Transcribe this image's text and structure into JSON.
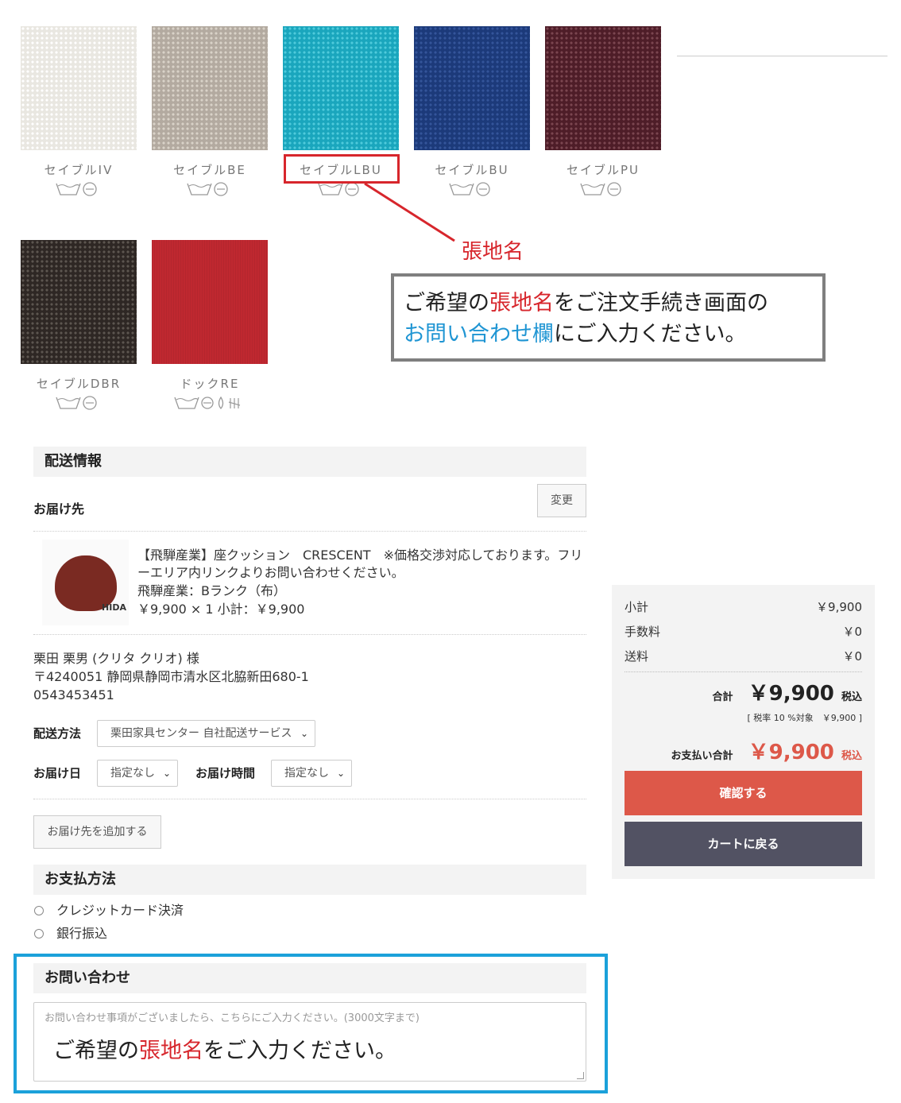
{
  "swatches": [
    {
      "name": "セイブルIV",
      "care_icons": "wash-tub, no-bleach-circle"
    },
    {
      "name": "セイブルBE",
      "care_icons": "wash-tub, no-bleach-circle"
    },
    {
      "name": "セイブルLBU",
      "care_icons": "wash-tub, no-bleach-circle"
    },
    {
      "name": "セイブルBU",
      "care_icons": "wash-tub, no-bleach-circle"
    },
    {
      "name": "セイブルPU",
      "care_icons": "wash-tub, no-bleach-circle"
    },
    {
      "name": "セイブルDBR",
      "care_icons": "wash-tub, no-bleach-circle"
    },
    {
      "name": "ドックRE",
      "care_icons": "wash-tub, no-bleach-circle, drop, steam"
    }
  ],
  "annotation": {
    "label": "張地名",
    "box_part1": "ご希望の",
    "box_red": "張地名",
    "box_part2": "をご注文手続き画面の",
    "box_blue": "お問い合わせ欄",
    "box_part3": "にご入力ください。",
    "accent_red": "#d7262c",
    "accent_blue": "#1ba1da"
  },
  "delivery": {
    "section_title": "配送情報",
    "destination_label": "お届け先",
    "change_button": "変更",
    "product": {
      "title": "【飛騨産業】座クッション　CRESCENT　※価格交渉対応しております。フリーエリア内リンクよりお問い合わせください。",
      "variant": "飛騨産業：Bランク（布）",
      "price_line": "￥9,900 × 1  小計：￥9,900",
      "image_brand": "HIDA"
    },
    "address": {
      "name": "栗田 栗男 (クリタ クリオ) 様",
      "postal_address": "〒4240051 静岡県静岡市清水区北脇新田680-1",
      "phone": "0543453451"
    },
    "method_label": "配送方法",
    "method_value": "栗田家具センター 自社配送サービス",
    "date_label": "お届け日",
    "date_value": "指定なし",
    "time_label": "お届け時間",
    "time_value": "指定なし",
    "add_destination_button": "お届け先を追加する"
  },
  "payment": {
    "section_title": "お支払方法",
    "options": [
      "クレジットカード決済",
      "銀行振込"
    ]
  },
  "inquiry": {
    "section_title": "お問い合わせ",
    "placeholder": "お問い合わせ事項がございましたら、こちらにご入力ください。(3000文字まで)",
    "overlay_part1": "ご希望の",
    "overlay_red": "張地名",
    "overlay_part2": "をご入力ください。"
  },
  "summary": {
    "subtotal_label": "小計",
    "subtotal_value": "￥9,900",
    "fee_label": "手数料",
    "fee_value": "￥0",
    "shipping_label": "送料",
    "shipping_value": "￥0",
    "total_label": "合計",
    "total_value": "￥9,900",
    "tax_incl": "税込",
    "tax_note": "[ 税率 10 %対象　￥9,900 ]",
    "payment_total_label": "お支払い合計",
    "payment_total_value": "￥9,900",
    "payment_tax_incl": "税込",
    "confirm_button": "確認する",
    "back_button": "カートに戻る",
    "accent": "#dd5849",
    "back_color": "#525263"
  }
}
